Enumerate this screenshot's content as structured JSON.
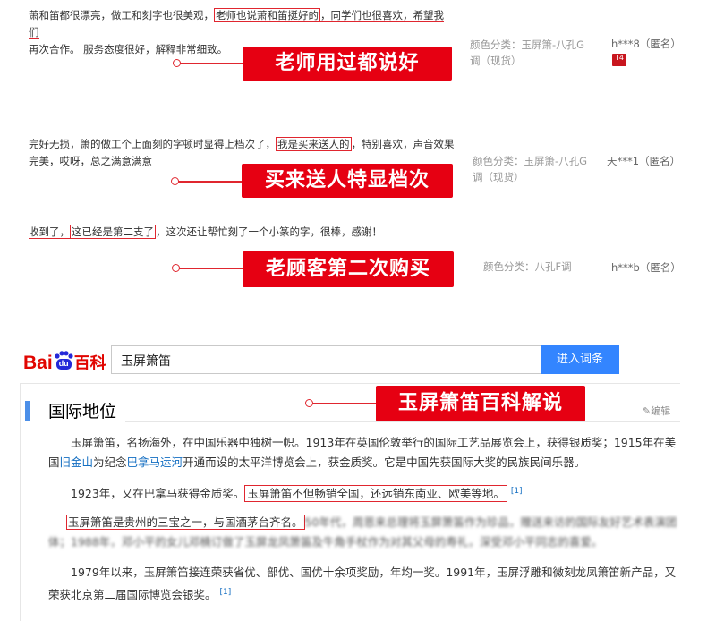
{
  "reviews": [
    {
      "text_a": "萧和笛都很漂亮，做工和刻字也很美观，",
      "highlight": "老师也说萧和笛挺好的",
      "text_b": "，同学们也很喜欢，希望我们",
      "text_line2": "再次合作。 服务态度很好，解释非常细致。",
      "meta": "颜色分类：玉屏箫-八孔G调（现货）",
      "user": "h***8（匿名）",
      "badge": "T4",
      "callout": "老师用过都说好"
    },
    {
      "text_a": "完好无损，箫的做工个上面刻的字顿时显得上档次了，",
      "highlight": "我是买来送人的",
      "text_b": "，特别喜欢，声音效果",
      "text_line2": "完美，哎呀，总之满意满意",
      "meta": "颜色分类：玉屏箫-八孔G调（现货）",
      "user": "天***1（匿名）",
      "callout": "买来送人特显档次"
    },
    {
      "text_a": "收到了，",
      "highlight": "这已经是第二支了",
      "text_b": "，这次还让帮忙刻了一个小篆的字，很棒，感谢！",
      "meta": "颜色分类：八孔F调",
      "user": "h***b（匿名）",
      "callout": "老顾客第二次购买"
    }
  ],
  "baidu": {
    "logo_bai": "Bai",
    "logo_du": "du",
    "logo_baike": "百科",
    "search_value": "玉屏箫笛",
    "search_button": "进入词条",
    "callout": "玉屏箫笛百科解说",
    "section_title": "国际地位",
    "edit_label": "编辑",
    "p1": {
      "text_a": "玉屏箫笛，名扬海外，在中国乐器中独树一帜。1913年在英国伦敦举行的国际工艺品展览会上，获得银质奖；1915年在美",
      "text_b": "国",
      "link1": "旧金山",
      "text_c": "为纪念",
      "link2": "巴拿马运河",
      "text_d": "开通而设的太平洋博览会上，获金质奖。它是中国先获国际大奖的民族民间乐器。"
    },
    "p2": {
      "text_a": "1923年，又在巴拿马获得金质奖。",
      "highlight": "玉屏箫笛不但畅销全国，还远销东南亚、欧美等地。",
      "ref": "[1]"
    },
    "p3": {
      "highlight": "玉屏箫笛是贵州的三宝之一，与国酒茅台齐名。",
      "blur_a": "50年代，周恩来总理将玉屏箫笛作为珍品，赠送来访的国际友好艺术表演团",
      "blur_b": "体；1988年，",
      "blur_link": "邓小平",
      "blur_c": "的女儿邓楠订做了玉屏龙凤箫笛及牛角手杖作为对其父母的寿礼，深受邓小平同志的喜爱。"
    },
    "p4": {
      "text_a": "1979年以来，玉屏箫笛接连荣获省优、部优、国优十余项奖励，年均一奖。1991年，玉屏浮雕和微刻龙凤箫笛新产品，又",
      "text_b": "荣获北京第二届国际博览会银奖。",
      "ref": "[1]"
    }
  }
}
